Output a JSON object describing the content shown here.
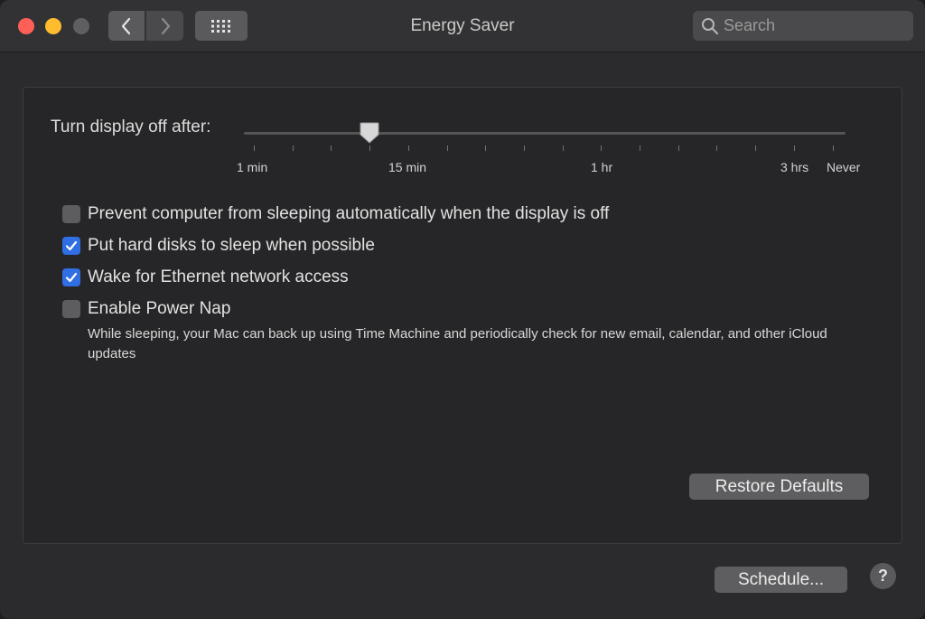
{
  "window": {
    "title": "Energy Saver"
  },
  "toolbar": {
    "back_icon": "chevron-left-icon",
    "forward_icon": "chevron-right-icon",
    "show_all_icon": "grid-icon"
  },
  "search": {
    "placeholder": "Search",
    "value": ""
  },
  "display_sleep": {
    "label": "Turn display off after:",
    "selected_value": "10 min",
    "ticks": [
      "1 min",
      "15 min",
      "1 hr",
      "3 hrs",
      "Never"
    ]
  },
  "options": [
    {
      "label": "Prevent computer from sleeping automatically when the display is off",
      "checked": false
    },
    {
      "label": "Put hard disks to sleep when possible",
      "checked": true
    },
    {
      "label": "Wake for Ethernet network access",
      "checked": true
    },
    {
      "label": "Enable Power Nap",
      "checked": false
    }
  ],
  "power_nap_note": "While sleeping, your Mac can back up using Time Machine and periodically check for new email, calendar, and other iCloud updates",
  "buttons": {
    "restore_defaults": "Restore Defaults",
    "schedule": "Schedule...",
    "help": "?"
  },
  "colors": {
    "accent": "#2f6ee3",
    "close": "#fe5f57",
    "minimize": "#febc2e"
  }
}
